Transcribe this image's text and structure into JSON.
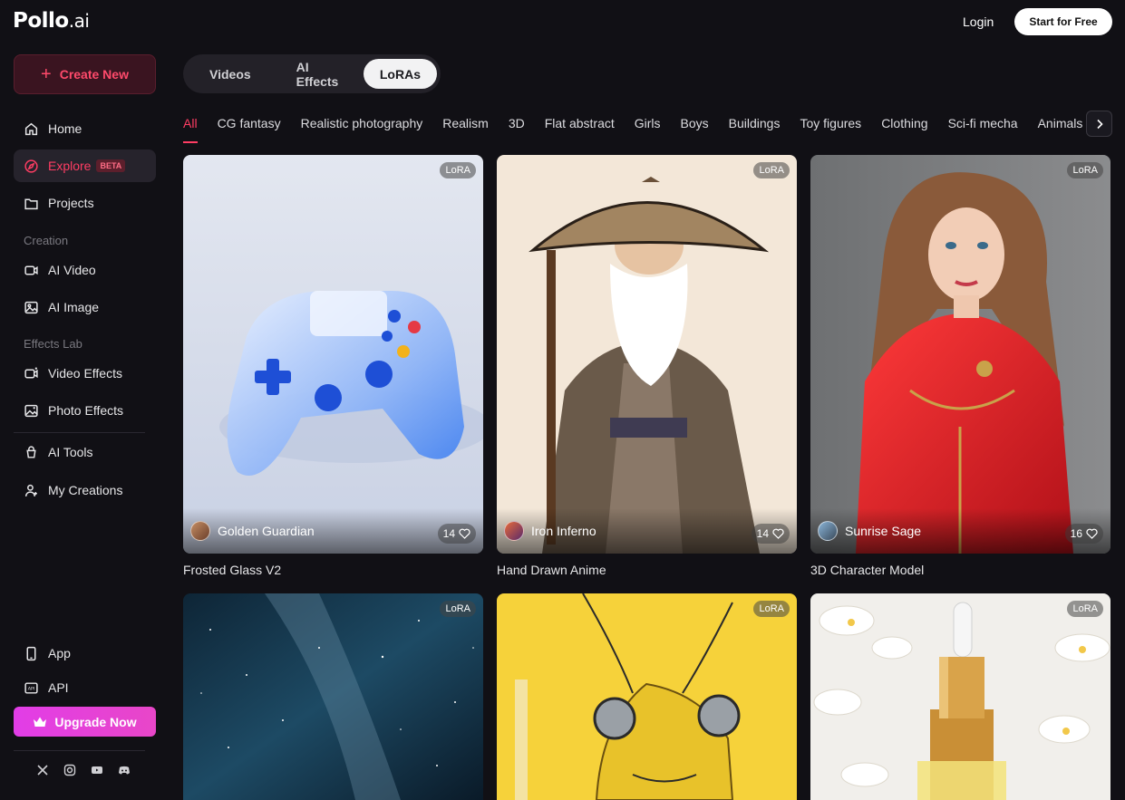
{
  "brand": {
    "name": "Pollo",
    "suffix": ".ai"
  },
  "header": {
    "login_label": "Login",
    "start_label": "Start for Free"
  },
  "sidebar": {
    "create_label": "Create New",
    "nav": [
      {
        "label": "Home",
        "icon": "home-icon"
      },
      {
        "label": "Explore",
        "icon": "compass-icon",
        "badge": "BETA"
      },
      {
        "label": "Projects",
        "icon": "folder-icon"
      }
    ],
    "creation_label": "Creation",
    "creation": [
      {
        "label": "AI Video",
        "icon": "video-icon"
      },
      {
        "label": "AI Image",
        "icon": "image-icon"
      }
    ],
    "effects_label": "Effects Lab",
    "effects": [
      {
        "label": "Video Effects",
        "icon": "video-effects-icon"
      },
      {
        "label": "Photo Effects",
        "icon": "photo-effects-icon"
      }
    ],
    "tools": [
      {
        "label": "AI Tools",
        "icon": "tools-icon"
      },
      {
        "label": "My Creations",
        "icon": "user-icon"
      }
    ],
    "bottom": [
      {
        "label": "App",
        "icon": "phone-icon"
      },
      {
        "label": "API",
        "icon": "api-icon"
      }
    ],
    "upgrade_label": "Upgrade Now",
    "socials": [
      "x-icon",
      "instagram-icon",
      "youtube-icon",
      "discord-icon"
    ]
  },
  "tabs": [
    "Videos",
    "AI Effects",
    "LoRAs"
  ],
  "active_tab": "LoRAs",
  "categories": [
    "All",
    "CG fantasy",
    "Realistic photography",
    "Realism",
    "3D",
    "Flat abstract",
    "Girls",
    "Boys",
    "Buildings",
    "Toy figures",
    "Clothing",
    "Sci-fi mecha",
    "Animals"
  ],
  "cards": [
    {
      "badge": "LoRA",
      "author": "Golden Guardian",
      "likes": "14",
      "title": "Frosted Glass V2"
    },
    {
      "badge": "LoRA",
      "author": "Iron Inferno",
      "likes": "14",
      "title": "Hand Drawn Anime"
    },
    {
      "badge": "LoRA",
      "author": "Sunrise Sage",
      "likes": "16",
      "title": "3D Character Model"
    },
    {
      "badge": "LoRA"
    },
    {
      "badge": "LoRA"
    },
    {
      "badge": "LoRA"
    }
  ],
  "colors": {
    "accent": "#ff3d63",
    "upgrade": "#e23de7",
    "background": "#111015"
  }
}
